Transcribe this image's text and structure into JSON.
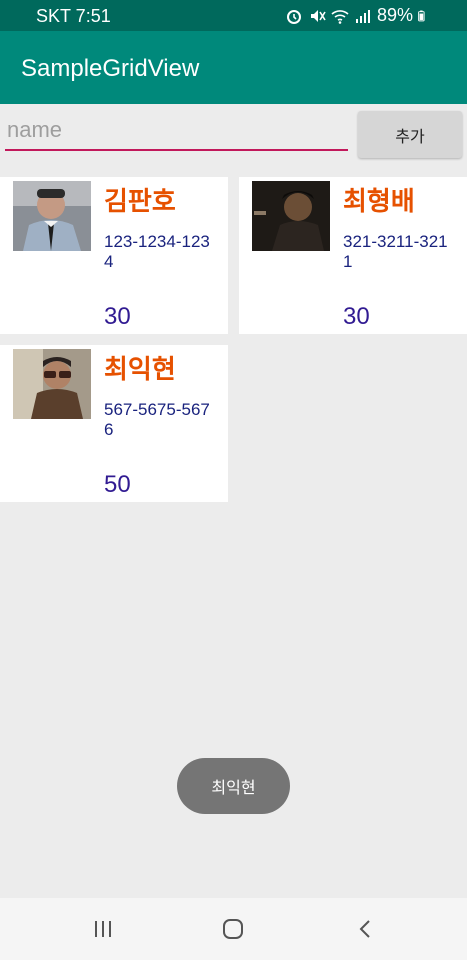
{
  "status_bar": {
    "carrier_time": "SKT 7:51",
    "battery": "89%"
  },
  "app_bar": {
    "title": "SampleGridView"
  },
  "form": {
    "name_placeholder": "name",
    "add_label": "추가"
  },
  "items": [
    {
      "name": "김판호",
      "phone": "123-1234-1234",
      "age": "30",
      "photo_icon": "portrait-man-suit"
    },
    {
      "name": "최형배",
      "phone": "321-3211-3211",
      "age": "30",
      "photo_icon": "portrait-man-dark"
    },
    {
      "name": "최익현",
      "phone": "567-5675-5676",
      "age": "50",
      "photo_icon": "portrait-man-sunglasses"
    }
  ],
  "toast": {
    "text": "최익현"
  },
  "nav": {
    "recents": "recents-icon",
    "home": "home-icon",
    "back": "back-icon"
  }
}
